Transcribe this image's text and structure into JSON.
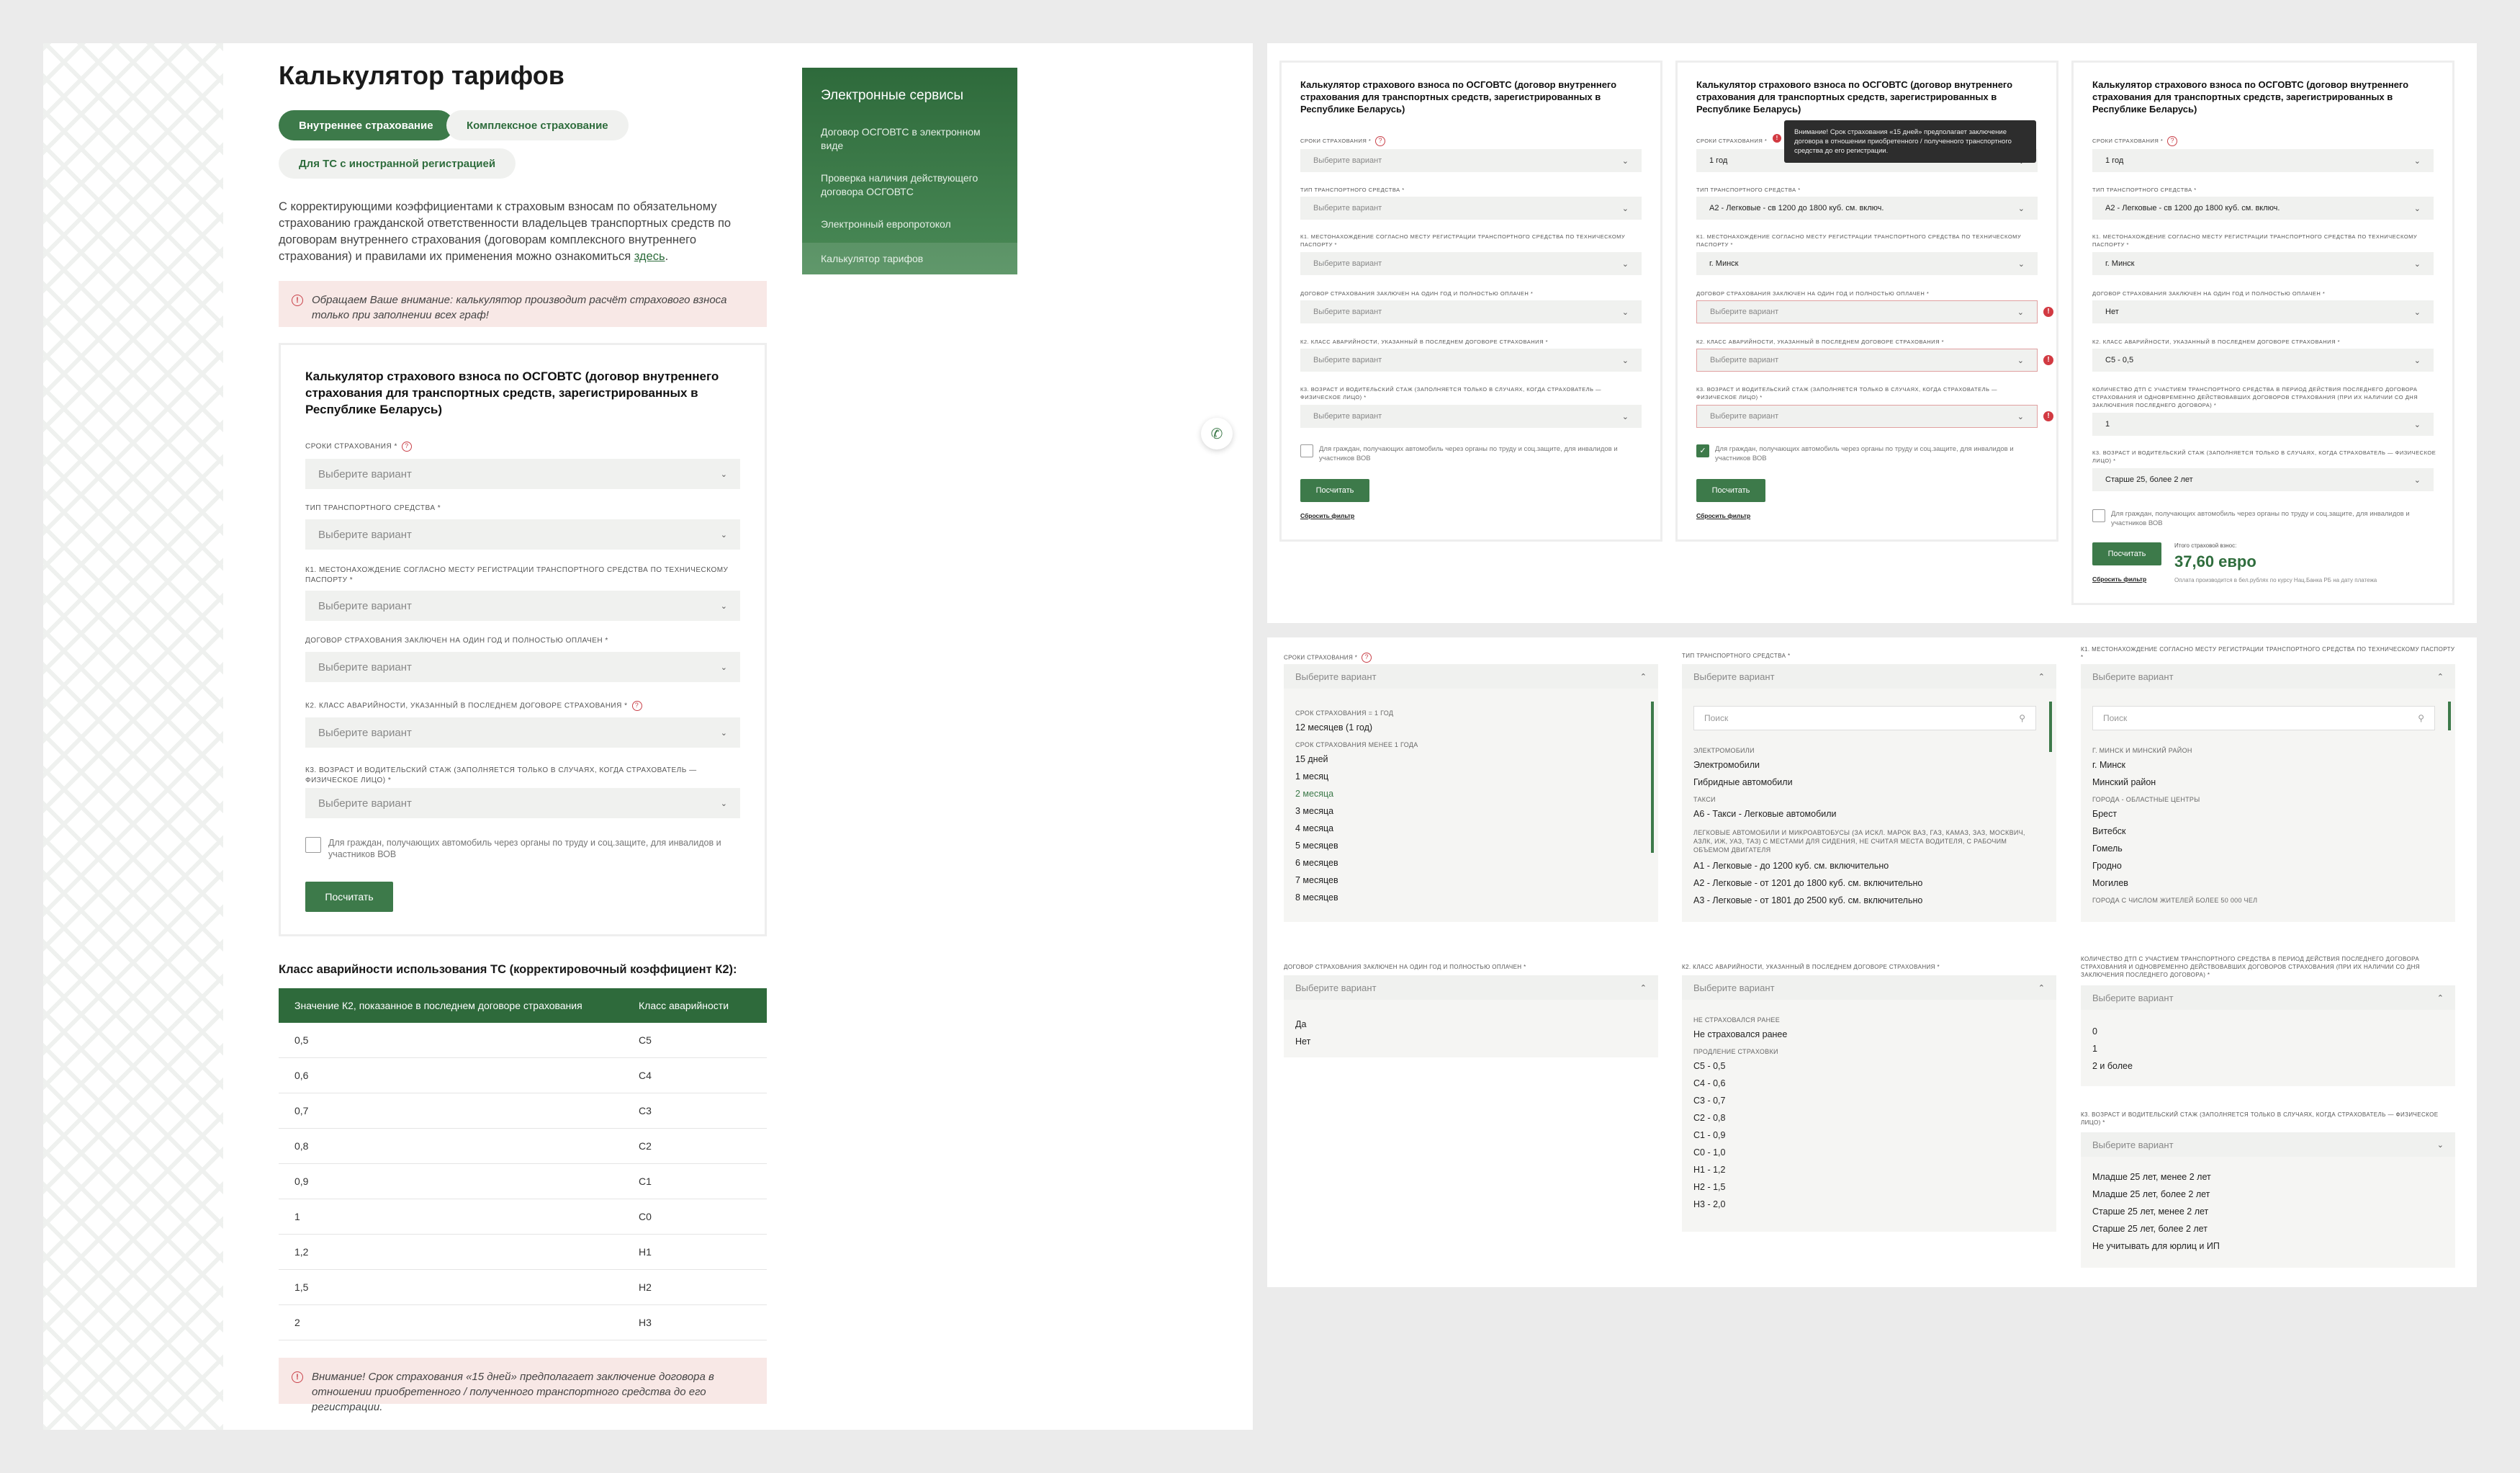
{
  "page": {
    "title": "Калькулятор тарифов"
  },
  "tabs": [
    "Внутреннее страхование",
    "Комплексное страхование",
    "Для ТС с иностранной регистрацией"
  ],
  "intro": {
    "text": "С корректирующими коэффициентами к страховым взносам по обязательному страхованию гражданской ответственности владельцев транспортных средств по договорам внутреннего страхования (договорам комплексного внутреннего страхования) и правилами их применения можно ознакомиться ",
    "link": "здесь",
    "end": "."
  },
  "notice_top": "Обращаем Ваше внимание: калькулятор производит расчёт страхового взноса только при заполнении всех граф!",
  "services": {
    "title": "Электронные сервисы",
    "items": [
      "Договор ОСГОВТС в электронном виде",
      "Проверка наличия действующего договора ОСГОВТС",
      "Электронный европротокол",
      "Калькулятор тарифов"
    ]
  },
  "form": {
    "title": "Калькулятор страхового взноса по ОСГОВТС (договор внутреннего страхования для транспортных средств, зарегистрированных в Республике Беларусь)",
    "labels": {
      "term": "Сроки страхования *",
      "vehicle": "Тип транспортного средства *",
      "k1": "К1. Местонахождение согласно месту регистрации транспортного средства по техническому паспорту *",
      "contract": "Договор страхования заключен на один год и полностью оплачен *",
      "k2": "К2. Класс аварийности, указанный в последнем договоре страхования *",
      "k3": "К3. Возраст и водительский стаж (заполняется только в случаях, когда страхователь — физическое лицо) *",
      "accidents": "Количество ДТП с участием транспортного средства в период действия последнего договора страхования и одновременно действовавших договоров страхования (при их наличии со дня заключения последнего договора) *"
    },
    "placeholder": "Выберите вариант",
    "checkbox": "Для граждан, получающих автомобиль через органы по труду и соц.защите, для инвалидов и участников ВОВ",
    "submit": "Посчитать",
    "reset": "Сбросить фильтр"
  },
  "k2_table": {
    "title": "Класс аварийности использования ТС (корректировочный коэффициент К2):",
    "headers": [
      "Значение К2, показанное в последнем договоре страхования",
      "Класс аварийности"
    ],
    "rows": [
      [
        "0,5",
        "С5"
      ],
      [
        "0,6",
        "С4"
      ],
      [
        "0,7",
        "С3"
      ],
      [
        "0,8",
        "С2"
      ],
      [
        "0,9",
        "С1"
      ],
      [
        "1",
        "С0"
      ],
      [
        "1,2",
        "Н1"
      ],
      [
        "1,5",
        "Н2"
      ],
      [
        "2",
        "Н3"
      ]
    ]
  },
  "notice_bottom": "Внимание! Срок страхования «15 дней» предполагает заключение договора в отношении приобретенного / полученного транспортного средства до его регистрации.",
  "state2": {
    "tooltip": "Внимание! Срок страхования «15 дней» предполагает заключение договора в отношении приобретенного / полученного транспортного средства до его регистрации.",
    "term": "1 год",
    "vehicle": "А2 - Легковые - св 1200 до 1800 куб. см. включ.",
    "k1": "г. Минск"
  },
  "state3": {
    "term": "1 год",
    "vehicle": "А2 - Легковые - св 1200 до 1800 куб. см. включ.",
    "k1": "г. Минск",
    "contract": "Нет",
    "k2": "С5 - 0,5",
    "accidents": "1",
    "k3": "Старше 25, более 2 лет",
    "total_label": "Итого страховой взнос:",
    "total_value": "37,60 евро",
    "total_note": "Оплата производится в бел.рублях по курсу Нац.Банка РБ на дату платежа"
  },
  "dd_term": {
    "g1": "Срок страхования = 1 год",
    "g1_items": [
      "12 месяцев (1 год)"
    ],
    "g2": "Срок страхования менее 1 года",
    "g2_items": [
      "15 дней",
      "1 месяц",
      "2 месяца",
      "3 месяца",
      "4 месяца",
      "5 месяцев",
      "6 месяцев",
      "7 месяцев",
      "8 месяцев"
    ]
  },
  "dd_vehicle": {
    "search": "Поиск",
    "g1": "Электромобили",
    "g1_items": [
      "Электромобили",
      "Гибридные автомобили"
    ],
    "g2": "Такси",
    "g2_items": [
      "А6 - Такси - Легковые автомобили"
    ],
    "g3": "Легковые автомобили и микроавтобусы (за искл. марок ВАЗ, ГАЗ, КАМАЗ, ЗАЗ, МОСКВИЧ, АЗЛК, ИЖ, УАЗ, ТАЗ) с местами для сидения, не считая места водителя, с рабочим объемом двигателя",
    "g3_items": [
      "А1 - Легковые - до 1200 куб. см. включительно",
      "А2 - Легковые - от 1201 до 1800 куб. см. включительно",
      "А3 - Легковые - от 1801 до 2500 куб. см. включительно"
    ]
  },
  "dd_k1": {
    "search": "Поиск",
    "g1": "г. Минск и Минский район",
    "g1_items": [
      "г. Минск",
      "Минский район"
    ],
    "g2": "Города - областные центры",
    "g2_items": [
      "Брест",
      "Витебск",
      "Гомель",
      "Гродно",
      "Могилев"
    ],
    "g3": "Города с числом жителей более 50 000 чел"
  },
  "dd_contract": {
    "items": [
      "Да",
      "Нет"
    ]
  },
  "dd_k2": {
    "g1": "Не страховался ранее",
    "g1_items": [
      "Не страховался ранее"
    ],
    "g2": "Продление страховки",
    "g2_items": [
      "С5 - 0,5",
      "С4 - 0,6",
      "С3 - 0,7",
      "С2 - 0,8",
      "С1 - 0,9",
      "С0 - 1,0",
      "Н1 - 1,2",
      "Н2 - 1,5",
      "Н3 - 2,0"
    ]
  },
  "dd_accidents": {
    "items": [
      "0",
      "1",
      "2 и более"
    ]
  },
  "dd_k3": {
    "items": [
      "Младше 25 лет, менее 2 лет",
      "Младше 25 лет, более 2 лет",
      "Старше 25 лет, менее 2 лет",
      "Старше 25 лет, более 2 лет",
      "Не учитывать для юрлиц и ИП"
    ]
  }
}
